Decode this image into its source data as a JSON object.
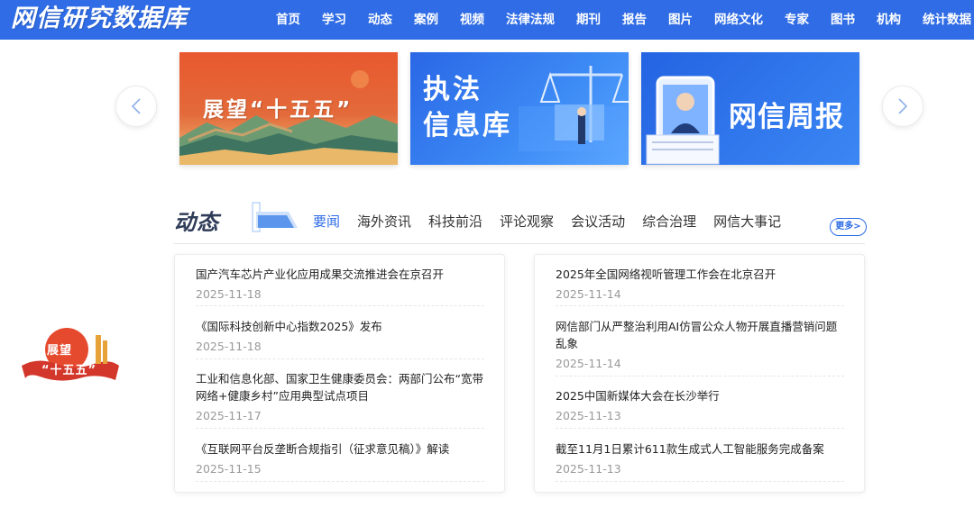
{
  "header": {
    "logo": "网信研究数据库",
    "nav": [
      "首页",
      "学习",
      "动态",
      "案例",
      "视频",
      "法律法规",
      "期刊",
      "报告",
      "图片",
      "网络文化",
      "专家",
      "图书",
      "机构",
      "统计数据"
    ]
  },
  "carousel": {
    "banners": [
      {
        "text": "展望“十五五”"
      },
      {
        "text_line1": "执法",
        "text_line2": "信息库"
      },
      {
        "text": "网信周报"
      }
    ],
    "prev_icon": "chevron-left-icon",
    "next_icon": "chevron-right-icon"
  },
  "section": {
    "title": "动态",
    "tabs": [
      "要闻",
      "海外资讯",
      "科技前沿",
      "评论观察",
      "会议活动",
      "综合治理",
      "网信大事记"
    ],
    "active_tab": "要闻",
    "more_label": "更多>"
  },
  "news": {
    "left": [
      {
        "title": "国产汽车芯片产业化应用成果交流推进会在京召开",
        "date": "2025-11-18"
      },
      {
        "title": "《国际科技创新中心指数2025》发布",
        "date": "2025-11-18"
      },
      {
        "title": "工业和信息化部、国家卫生健康委员会：两部门公布“宽带网络+健康乡村”应用典型试点项目",
        "date": "2025-11-17"
      },
      {
        "title": "《互联网平台反垄断合规指引（征求意见稿）》解读",
        "date": "2025-11-15"
      }
    ],
    "right": [
      {
        "title": "2025年全国网络视听管理工作会在北京召开",
        "date": "2025-11-14"
      },
      {
        "title": "网信部门从严整治利用AI仿冒公众人物开展直播营销问题乱象",
        "date": "2025-11-14"
      },
      {
        "title": "2025中国新媒体大会在长沙举行",
        "date": "2025-11-13"
      },
      {
        "title": "截至11月1日累计611款生成式人工智能服务完成备案",
        "date": "2025-11-13"
      }
    ]
  },
  "badge": {
    "line1": "展望",
    "line2": "“十五五”"
  },
  "colors": {
    "primary": "#2f6ce5",
    "banner_red": "#e8582f",
    "title_dark": "#2f3c58"
  }
}
